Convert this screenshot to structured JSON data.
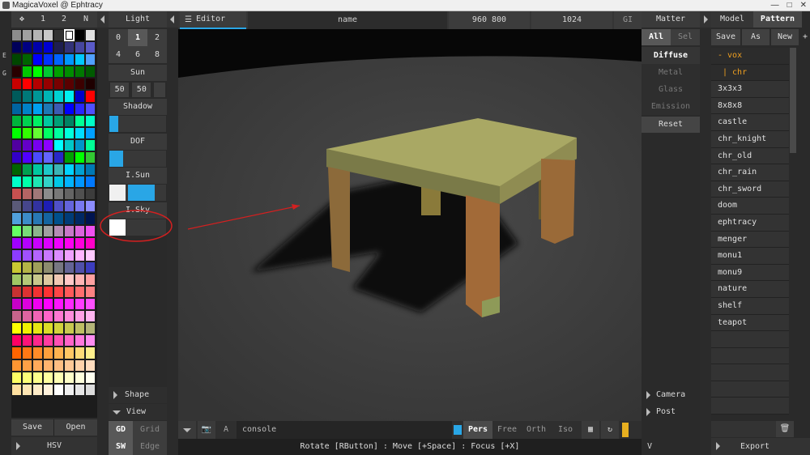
{
  "window": {
    "title": "MagicaVoxel @ Ephtracy"
  },
  "left_toolbar": {
    "tab1": "1",
    "tab2": "2",
    "tab3": "N",
    "side_e": "E",
    "side_g": "G"
  },
  "palette": {
    "colors": [
      "#8c8c8c",
      "#a0a0a0",
      "#b4b4b4",
      "#c8c8c8",
      "#323232",
      "#ffffff",
      "#000000",
      "#e0e0e0",
      "#00005a",
      "#000082",
      "#0000aa",
      "#0000d2",
      "#1e1e50",
      "#323278",
      "#4646a0",
      "#5a5ac8",
      "#004600",
      "#006400",
      "#0000ff",
      "#0032ff",
      "#0064ff",
      "#0096ff",
      "#00c8ff",
      "#50a0ff",
      "#280000",
      "#00c800",
      "#00ff00",
      "#00c832",
      "#00a000",
      "#008c00",
      "#007800",
      "#005a00",
      "#c80000",
      "#ff0000",
      "#b40000",
      "#960000",
      "#780000",
      "#5a0000",
      "#3c0000",
      "#1e0000",
      "#005a5a",
      "#007878",
      "#009696",
      "#00b4b4",
      "#00d2d2",
      "#00f0f0",
      "#0000c8",
      "#ff0000",
      "#0064a0",
      "#0082c8",
      "#00a0f0",
      "#1e78b4",
      "#3c5ab4",
      "#0000ff",
      "#2828ff",
      "#5050ff",
      "#00b43c",
      "#00d250",
      "#00f064",
      "#00c8a0",
      "#00a078",
      "#008264",
      "#00ff96",
      "#00ffc8",
      "#00ff00",
      "#32ff00",
      "#64ff32",
      "#00ff64",
      "#00ffa0",
      "#00ffdc",
      "#00dcff",
      "#00a0ff",
      "#5000a0",
      "#6400c8",
      "#7800f0",
      "#8c00ff",
      "#00ffff",
      "#00c8c8",
      "#0096c8",
      "#00ff96",
      "#3200c8",
      "#5000ff",
      "#4b4bff",
      "#6464ff",
      "#2828c8",
      "#00a000",
      "#00ff00",
      "#32c832",
      "#006400",
      "#00a050",
      "#00c8a0",
      "#1ec8c8",
      "#3cb4b4",
      "#00d2ff",
      "#00a0d2",
      "#0078b4",
      "#00ffc8",
      "#00ffaa",
      "#1ee6b4",
      "#32d2c8",
      "#00c8e6",
      "#00b4ff",
      "#0096ff",
      "#0078ff",
      "#c85050",
      "#b46464",
      "#a07878",
      "#8c8c8c",
      "#787878",
      "#646464",
      "#505050",
      "#3c3c3c",
      "#5a5a78",
      "#46468c",
      "#3232a0",
      "#1e1eb4",
      "#5050c8",
      "#6464dc",
      "#7878f0",
      "#8c8cff",
      "#50a0dc",
      "#3c8cc8",
      "#2878b4",
      "#1464a0",
      "#00508c",
      "#003c78",
      "#002864",
      "#001450",
      "#64ff64",
      "#78dc78",
      "#8cb48c",
      "#a0a0a0",
      "#b48cb4",
      "#c878c8",
      "#dc64dc",
      "#f050f0",
      "#a000ff",
      "#b400ff",
      "#c800ff",
      "#dc00ff",
      "#f000ff",
      "#ff00f0",
      "#ff00dc",
      "#ff00c8",
      "#8c3cff",
      "#a050ff",
      "#b464ff",
      "#c878ff",
      "#dc8cff",
      "#f0a0ff",
      "#ffb4ff",
      "#ffc8ff",
      "#c8c832",
      "#b4b446",
      "#a0a05a",
      "#8c8c6e",
      "#787882",
      "#646496",
      "#5050aa",
      "#3c3cbe",
      "#a0c864",
      "#b4c878",
      "#c8c88c",
      "#dcc8a0",
      "#f0c8b4",
      "#ffc8c8",
      "#ffb4b4",
      "#ffa0a0",
      "#c83232",
      "#dc3232",
      "#f03232",
      "#ff3232",
      "#ff4646",
      "#ff5a5a",
      "#ff6e6e",
      "#ff8282",
      "#c800c8",
      "#dc00dc",
      "#f000f0",
      "#ff00ff",
      "#ff14ff",
      "#ff28ff",
      "#ff3cff",
      "#ff50ff",
      "#c8648c",
      "#dc64a0",
      "#f064b4",
      "#ff64c8",
      "#ff78d2",
      "#ff8cdc",
      "#ffa0e6",
      "#ffb4f0",
      "#ffff00",
      "#f0f000",
      "#e6e614",
      "#dcdc28",
      "#d2d23c",
      "#c8c850",
      "#bebe64",
      "#b4b478",
      "#ff0064",
      "#ff1478",
      "#ff288c",
      "#ff3ca0",
      "#ff50b4",
      "#ff64c8",
      "#ff78dc",
      "#ff8cf0",
      "#ff6400",
      "#ff7814",
      "#ff8c28",
      "#ffa03c",
      "#ffb450",
      "#ffc864",
      "#ffdc78",
      "#fff08c",
      "#ff9632",
      "#ffa046",
      "#ffaa5a",
      "#ffb46e",
      "#ffbe82",
      "#ffc896",
      "#ffd2aa",
      "#ffdcbe",
      "#ffff64",
      "#ffff78",
      "#ffff8c",
      "#ffffa0",
      "#ffffb4",
      "#ffffc8",
      "#ffffdc",
      "#fffff0",
      "#ffe0a0",
      "#ffe6b4",
      "#ffecc8",
      "#fff2dc",
      "#ffffff",
      "#f0f0f0",
      "#e6e6e6",
      "#dcdcdc"
    ],
    "save_label": "Save",
    "open_label": "Open",
    "hsv_label": "HSV"
  },
  "light_panel": {
    "header": "Light",
    "tabs_row1": [
      "0",
      "1",
      "2"
    ],
    "tabs_row2": [
      "4",
      "6",
      "8"
    ],
    "sun_label": "Sun",
    "sun_values": [
      "50",
      "50"
    ],
    "shadow_label": "Shadow",
    "dof_label": "DOF",
    "isun_label": "I.Sun",
    "isky_label": "I.Sky",
    "shape_label": "Shape",
    "view_label": "View",
    "gd_label": "GD",
    "grid_label": "Grid",
    "sw_label": "SW",
    "edge_label": "Edge"
  },
  "editor_header": {
    "editor_tab": "Editor",
    "name": "name",
    "resolution": "960 800",
    "samples": "1024",
    "gi": "GI"
  },
  "viewport_bottom": {
    "console": "console",
    "a_label": "A",
    "pers": "Pers",
    "free": "Free",
    "orth": "Orth",
    "iso": "Iso"
  },
  "status": {
    "text": "Rotate [RButton] : Move [+Space] : Focus [+X]"
  },
  "matter_panel": {
    "header": "Matter",
    "all": "All",
    "sel": "Sel",
    "materials": [
      "Diffuse",
      "Metal",
      "Glass",
      "Emission"
    ],
    "reset": "Reset",
    "camera": "Camera",
    "post": "Post",
    "v": "V"
  },
  "right_panel": {
    "tab_model": "Model",
    "tab_pattern": "Pattern",
    "save": "Save",
    "as": "As",
    "new": "New",
    "plus": "+",
    "files": [
      "- vox",
      "| chr",
      "3x3x3",
      "8x8x8",
      "castle",
      "chr_knight",
      "chr_old",
      "chr_rain",
      "chr_sword",
      "doom",
      "ephtracy",
      "menger",
      "monu1",
      "monu9",
      "nature",
      "shelf",
      "teapot"
    ],
    "export": "Export"
  },
  "colors": {
    "accent": "#29a6e6",
    "selected_file": "#f0a020",
    "annotation": "#d42020"
  }
}
